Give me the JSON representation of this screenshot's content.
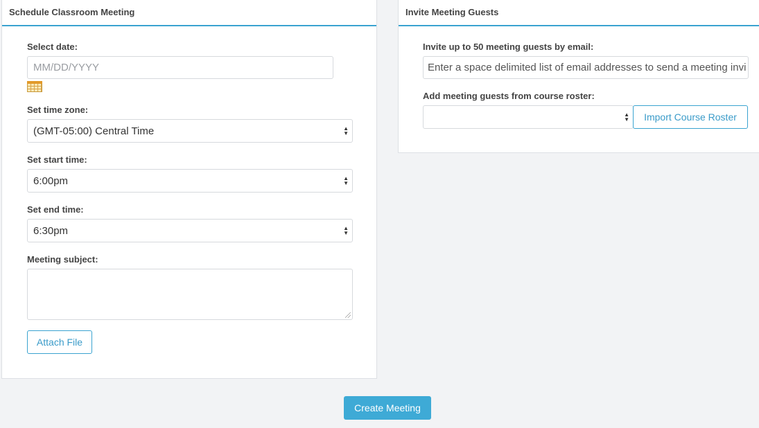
{
  "schedule_panel": {
    "title": "Schedule Classroom Meeting",
    "date": {
      "label": "Select date:",
      "placeholder": "MM/DD/YYYY",
      "icon": "calendar-icon"
    },
    "timezone": {
      "label": "Set time zone:",
      "value": "(GMT-05:00) Central Time"
    },
    "start_time": {
      "label": "Set start time:",
      "value": "6:00pm"
    },
    "end_time": {
      "label": "Set end time:",
      "value": "6:30pm"
    },
    "subject": {
      "label": "Meeting subject:",
      "value": ""
    },
    "attach_label": "Attach File"
  },
  "invite_panel": {
    "title": "Invite Meeting Guests",
    "email": {
      "label": "Invite up to 50 meeting guests by email:",
      "placeholder": "Enter a space delimited list of email addresses to send a meeting invi"
    },
    "roster": {
      "label": "Add meeting guests from course roster:",
      "value": ""
    },
    "import_label": "Import Course Roster"
  },
  "create_label": "Create Meeting",
  "colors": {
    "accent": "#3aa3d0",
    "primary_button": "#3eaad6",
    "background": "#f2f3f5"
  }
}
